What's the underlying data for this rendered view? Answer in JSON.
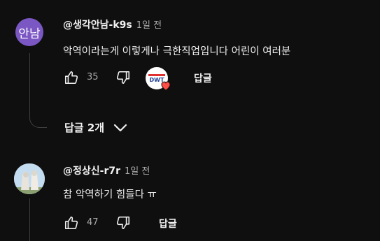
{
  "comments": [
    {
      "avatar_text": "안남",
      "avatar_color": "#7b57c4",
      "author": "@생각안남-k9s",
      "timestamp": "1일 전",
      "text": "악역이라는게 이렇게나 극한직업입니다 어린이 여러분",
      "likes": "35",
      "reply_label": "답글",
      "has_creator_heart": true,
      "replies_toggle_label": "답글 2개"
    },
    {
      "avatar_icon": "merlion-statue-avatar",
      "author": "@정상신-r7r",
      "timestamp": "1일 전",
      "text": "참 악역하기 힘들다 ㅠ",
      "likes": "47",
      "reply_label": "답글"
    }
  ],
  "creator_badge": {
    "logo_text": "DWT",
    "heart_color": "#ff4e45"
  },
  "colors": {
    "background": "#0f0f0f",
    "primary_text": "#f1f1f1",
    "secondary_text": "#aaaaaa"
  }
}
